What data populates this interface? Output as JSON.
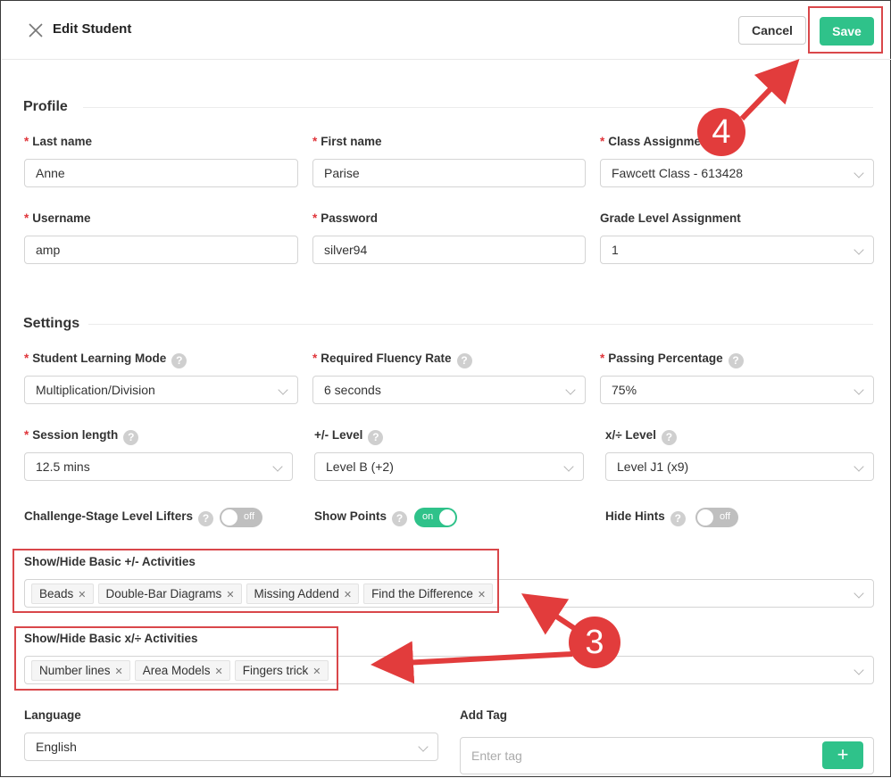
{
  "header": {
    "title": "Edit Student",
    "cancel_label": "Cancel",
    "save_label": "Save"
  },
  "profile": {
    "section_title": "Profile",
    "last_name": {
      "label": "Last name",
      "value": "Anne"
    },
    "first_name": {
      "label": "First name",
      "value": "Parise"
    },
    "class_assignment": {
      "label": "Class Assignment",
      "value": "Fawcett Class - 613428"
    },
    "username": {
      "label": "Username",
      "value": "amp"
    },
    "password": {
      "label": "Password",
      "value": "silver94"
    },
    "grade_level": {
      "label": "Grade Level Assignment",
      "value": "1"
    }
  },
  "settings": {
    "section_title": "Settings",
    "learning_mode": {
      "label": "Student Learning Mode",
      "value": "Multiplication/Division"
    },
    "fluency_rate": {
      "label": "Required Fluency Rate",
      "value": "6 seconds"
    },
    "passing_percentage": {
      "label": "Passing Percentage",
      "value": "75%"
    },
    "session_length": {
      "label": "Session length",
      "value": "12.5 mins"
    },
    "add_level": {
      "label": "+/- Level",
      "value": "Level B (+2)"
    },
    "mult_level": {
      "label": "x/÷ Level",
      "value": "Level J1 (x9)"
    },
    "level_lifters": {
      "label": "Challenge-Stage Level Lifters",
      "state": "off"
    },
    "show_points": {
      "label": "Show Points",
      "state": "on"
    },
    "hide_hints": {
      "label": "Hide Hints",
      "state": "off"
    },
    "basic_add_activities": {
      "label": "Show/Hide Basic +/- Activities",
      "tags": [
        "Beads",
        "Double-Bar Diagrams",
        "Missing Addend",
        "Find the Difference"
      ]
    },
    "basic_mult_activities": {
      "label": "Show/Hide Basic x/÷ Activities",
      "tags": [
        "Number lines",
        "Area Models",
        "Fingers trick"
      ]
    },
    "language": {
      "label": "Language",
      "value": "English"
    },
    "add_tag": {
      "label": "Add Tag",
      "placeholder": "Enter tag",
      "button": "+"
    }
  },
  "help_glyph": "?",
  "annotations": {
    "step3": "3",
    "step4": "4",
    "color": "#e23c3c"
  },
  "colors": {
    "accent": "#2fc28a",
    "required": "#e0353b"
  }
}
